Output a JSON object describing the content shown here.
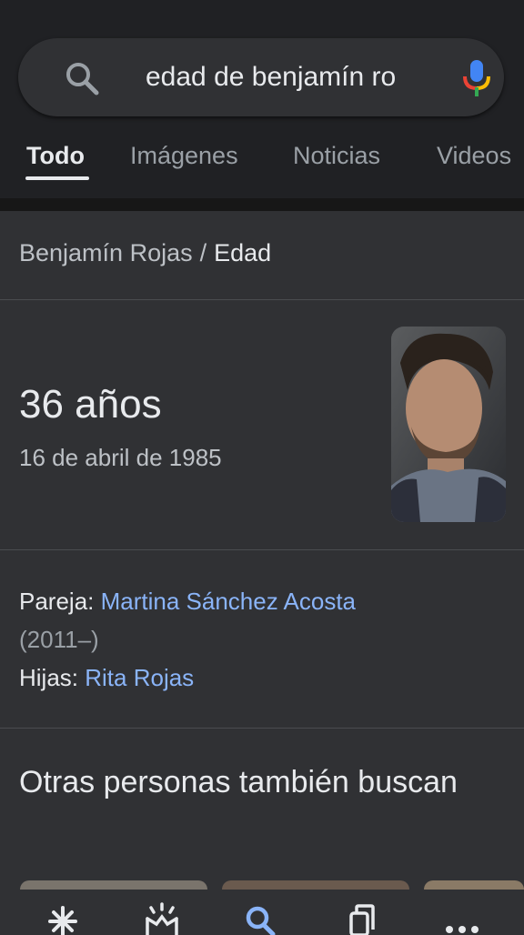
{
  "search": {
    "query": "edad de benjamín ro"
  },
  "tabs": [
    {
      "label": "Todo"
    },
    {
      "label": "Imágenes"
    },
    {
      "label": "Noticias"
    },
    {
      "label": "Videos"
    }
  ],
  "breadcrumb": {
    "parent": "Benjamín Rojas",
    "separator": "/",
    "current": "Edad"
  },
  "answer": {
    "age": "36 años",
    "birth_date": "16 de abril de 1985"
  },
  "facts": {
    "partner_label": "Pareja:",
    "partner_name": "Martina Sánchez Acosta",
    "partner_years": "(2011–)",
    "daughters_label": "Hijas:",
    "daughter_name": "Rita Rojas"
  },
  "related": {
    "heading": "Otras personas también buscan"
  },
  "bottom_nav": [
    "discover-icon",
    "snapshot-icon",
    "search-icon",
    "tabs-icon",
    "more-icon"
  ],
  "colors": {
    "background": "#303134",
    "topbar": "#202124",
    "link": "#8ab4f8",
    "active_nav": "#8ab4f8"
  }
}
